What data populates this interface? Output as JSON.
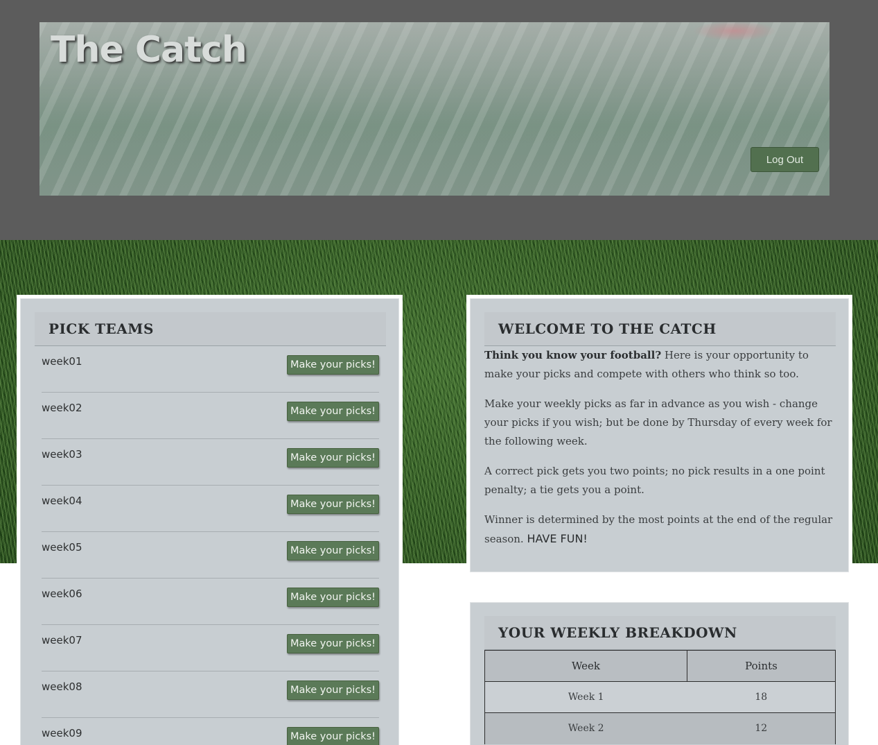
{
  "header": {
    "site_title": "The Catch",
    "logout_label": "Log Out"
  },
  "pick_teams": {
    "title": "PICK TEAMS",
    "button_label": "Make your picks!",
    "weeks": [
      "week01",
      "week02",
      "week03",
      "week04",
      "week05",
      "week06",
      "week07",
      "week08",
      "week09"
    ]
  },
  "welcome": {
    "title": "WELCOME TO THE CATCH",
    "p1_lead": "Think you know your football?",
    "p1_rest": " Here is your opportunity to make your picks and compete with others who think so too.",
    "p2": "Make your weekly picks as far in advance as you wish - change your picks if you wish; but be done by Thursday of every week for the following week.",
    "p3": "A correct pick gets you two points; no pick results in a one point penalty; a tie gets you a point.",
    "p4_text": "Winner is determined by the most points at the end of the regular season. ",
    "p4_emph": "HAVE FUN!"
  },
  "weekly_breakdown": {
    "title": "YOUR WEEKLY BREAKDOWN",
    "columns": [
      "Week",
      "Points"
    ],
    "rows": [
      {
        "week": "Week 1",
        "points": "18"
      },
      {
        "week": "Week 2",
        "points": "12"
      }
    ]
  },
  "colors": {
    "header_band": "#5c5c5c",
    "button_green": "#5b7a58",
    "panel_bg": "#c8ced2"
  }
}
